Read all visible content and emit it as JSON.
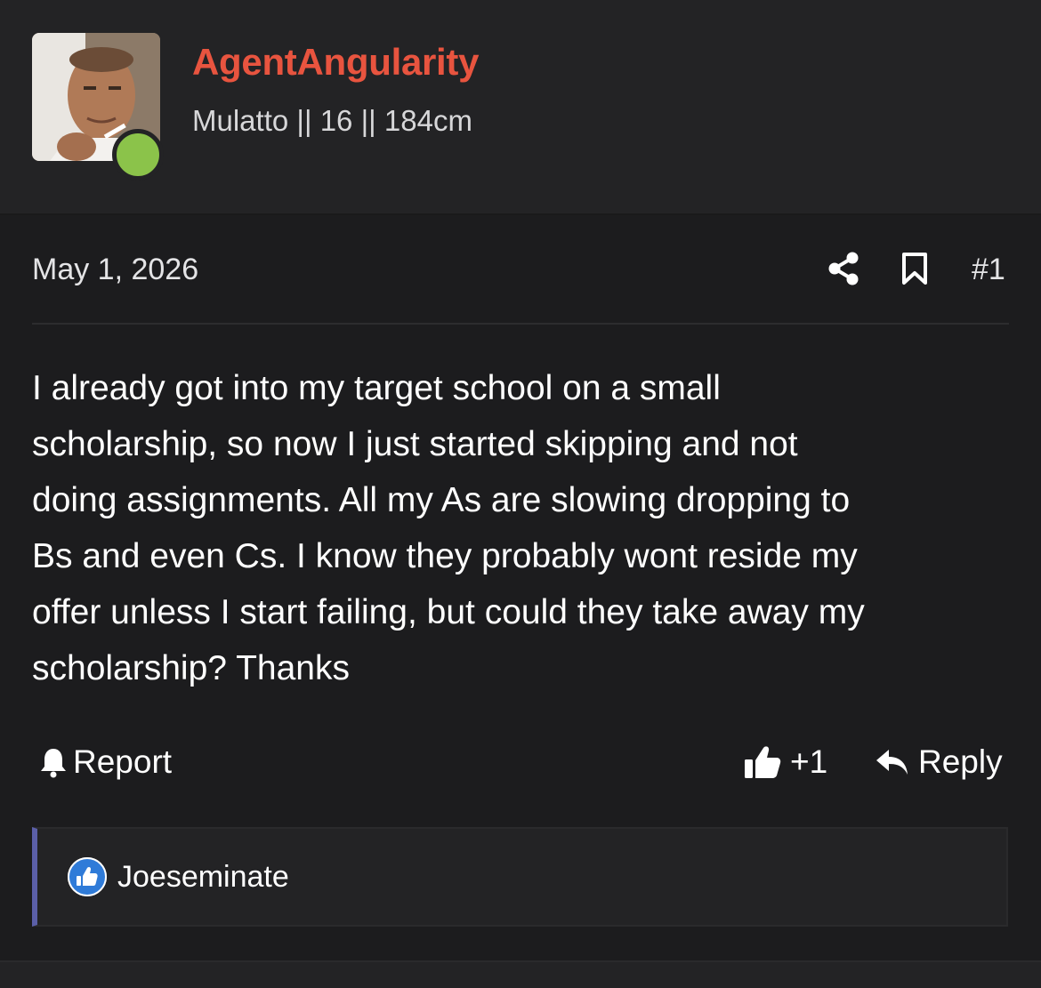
{
  "post": {
    "author": {
      "username": "AgentAngularity",
      "user_title": "Mulatto || 16 || 184cm",
      "online_status": "online",
      "avatar_icon": "profile-photo"
    },
    "date": "May 1, 2026",
    "post_number": "#1",
    "body_lines": [
      "I already got into my target school on a small",
      "scholarship, so now I just started skipping and not",
      "doing assignments. All my As are slowing dropping to",
      "Bs and even Cs. I know they probably wont reside my",
      "offer unless I start failing, but could they take away my",
      "scholarship? Thanks"
    ],
    "actions": {
      "report_label": "Report",
      "like_count": "+1",
      "reply_label": "Reply"
    },
    "reactions": {
      "users": [
        "Joeseminate"
      ],
      "reaction_type": "like"
    }
  },
  "colors": {
    "background": "#1c1c1e",
    "header_bg": "#232325",
    "username": "#e8543f",
    "online": "#8bc34a",
    "reaction_border": "#5b5fa8",
    "like_blue": "#2f7bd8"
  },
  "icons": {
    "share": "share-icon",
    "bookmark": "bookmark-icon",
    "report": "bell-icon",
    "like": "thumbs-up-icon",
    "reply": "reply-arrow-icon"
  }
}
